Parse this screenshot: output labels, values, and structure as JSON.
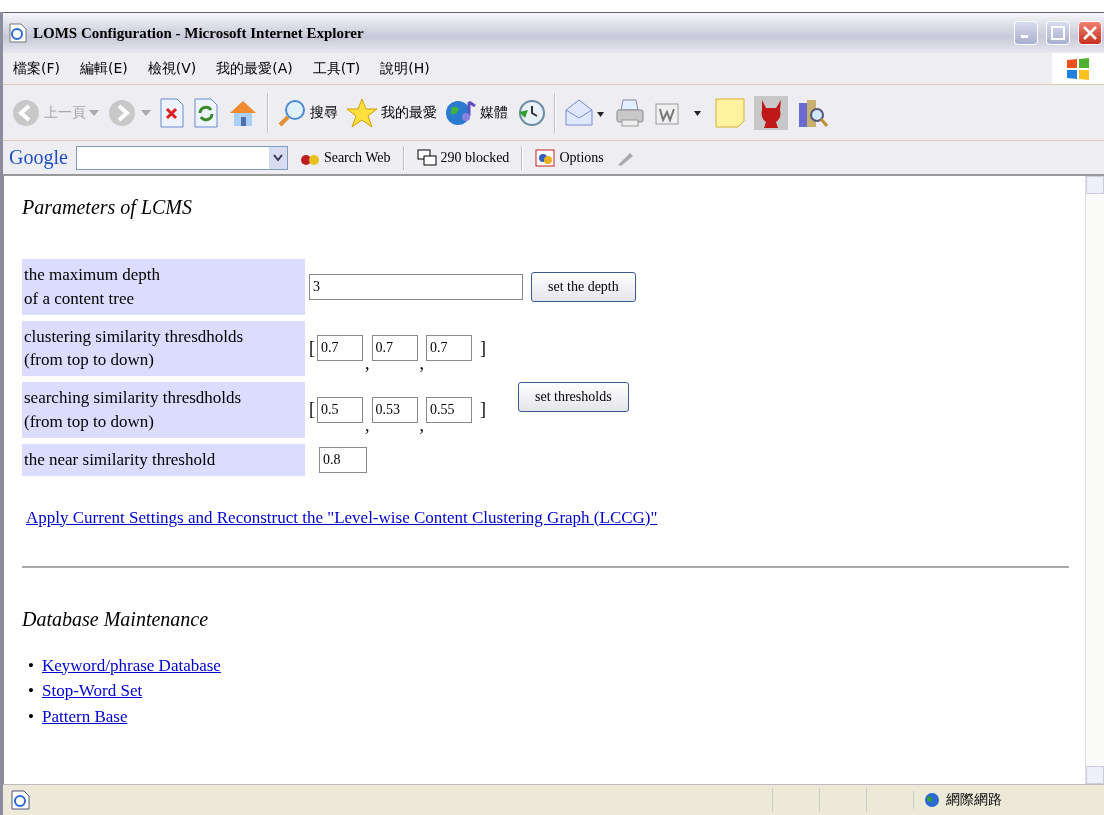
{
  "window": {
    "title": "LOMS Configuration - Microsoft Internet Explorer"
  },
  "menu": [
    "檔案(F)",
    "編輯(E)",
    "檢視(V)",
    "我的最愛(A)",
    "工具(T)",
    "說明(H)"
  ],
  "toolbar": [
    {
      "kind": "back",
      "label": "上一頁",
      "disabled": true
    },
    {
      "kind": "forward",
      "disabled": true
    },
    {
      "kind": "stop"
    },
    {
      "kind": "refresh"
    },
    {
      "kind": "home"
    },
    {
      "kind": "sep"
    },
    {
      "kind": "search",
      "label": "搜尋"
    },
    {
      "kind": "favorites",
      "label": "我的最愛"
    },
    {
      "kind": "media",
      "label": "媒體"
    },
    {
      "kind": "history"
    },
    {
      "kind": "sep"
    },
    {
      "kind": "mail"
    },
    {
      "kind": "print"
    },
    {
      "kind": "word"
    },
    {
      "kind": "note"
    },
    {
      "kind": "horned"
    },
    {
      "kind": "books"
    }
  ],
  "google_bar": {
    "logo": "Google",
    "search_button": "Search Web",
    "blocked": "290 blocked",
    "options": "Options"
  },
  "page": {
    "heading": "Parameters of LCMS",
    "rows": [
      {
        "kind": "depth",
        "label": [
          "the maximum depth",
          "of a content tree"
        ],
        "values": [
          "3"
        ],
        "button": "set the depth"
      },
      {
        "kind": "triple",
        "label": [
          "clustering similarity thresdholds",
          "(from top to down)"
        ],
        "open": "[",
        "sep": ",",
        "close": "]",
        "values": [
          "0.7",
          "0.7",
          "0.7"
        ]
      },
      {
        "kind": "triple",
        "label": [
          "searching similarity thresdholds",
          "(from top to down)"
        ],
        "open": "[",
        "sep": ",",
        "close": "]",
        "values": [
          "0.5",
          "0.53",
          "0.55"
        ],
        "button": "set thresholds"
      },
      {
        "kind": "single",
        "label": [
          "the near similarity threshold"
        ],
        "values": [
          "0.8"
        ]
      }
    ],
    "apply_link": "Apply Current Settings and Reconstruct the \"Level-wise Content Clustering Graph (LCCG)\"",
    "heading2": "Database Maintenance",
    "links": [
      {
        "bullet": "•",
        "label": "Keyword/phrase Database"
      },
      {
        "bullet": "•",
        "label": "Stop-Word Set"
      },
      {
        "bullet": "•",
        "label": "Pattern Base"
      }
    ]
  },
  "status_bar": {
    "zone": "網際網路"
  }
}
